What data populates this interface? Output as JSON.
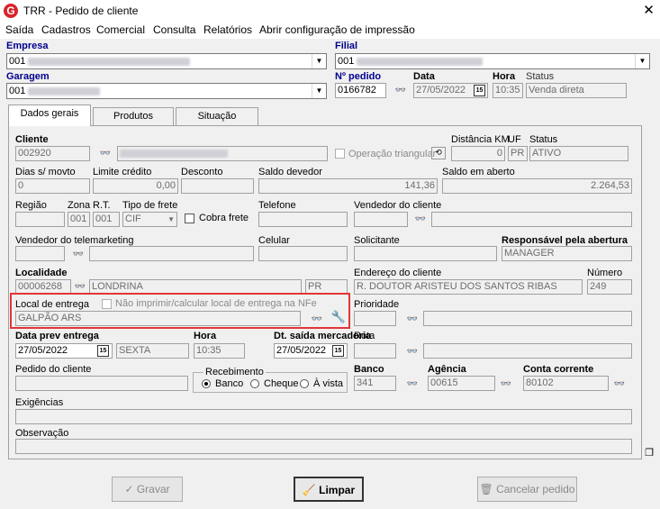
{
  "window": {
    "title": "TRR - Pedido de cliente",
    "logo": "G",
    "close": "✕"
  },
  "menu": [
    "Saída",
    "Cadastros",
    "Comercial",
    "Consulta",
    "Relatórios",
    "Abrir configuração de impressão"
  ],
  "header": {
    "empresa_label": "Empresa",
    "empresa_value": "001",
    "filial_label": "Filial",
    "filial_value": "001",
    "garagem_label": "Garagem",
    "garagem_value": "001",
    "pedido_label": "Nº pedido",
    "pedido_value": "0166782",
    "data_label": "Data",
    "data_value": "27/05/2022",
    "hora_label": "Hora",
    "hora_value": "10:35",
    "status_label": "Status",
    "status_value": "Venda direta"
  },
  "tabs": [
    "Dados gerais",
    "Produtos",
    "Situação"
  ],
  "form": {
    "cliente_label": "Cliente",
    "cliente_value": "002920",
    "operacao_label": "Operação triangular",
    "distancia_label": "Distância KM",
    "distancia_value": "0",
    "uf_label": "UF",
    "uf_value": "PR",
    "status_label": "Status",
    "status_value": "ATIVO",
    "dias_label": "Dias s/ movto",
    "dias_value": "0",
    "limite_label": "Limite crédito",
    "limite_value": "0,00",
    "desconto_label": "Desconto",
    "desconto_value": "",
    "saldo_devedor_label": "Saldo devedor",
    "saldo_devedor_value": "141,36",
    "saldo_aberto_label": "Saldo em aberto",
    "saldo_aberto_value": "2.264,53",
    "regiao_label": "Região",
    "zona_label": "Zona",
    "zona_value": "001",
    "rt_label": "R.T.",
    "rt_value": "001",
    "frete_label": "Tipo de frete",
    "frete_value": "CIF",
    "cobra_frete_label": "Cobra frete",
    "telefone_label": "Telefone",
    "vendedor_cliente_label": "Vendedor do cliente",
    "vendedor_tele_label": "Vendedor do telemarketing",
    "celular_label": "Celular",
    "solicitante_label": "Solicitante",
    "responsavel_label": "Responsável pela abertura",
    "responsavel_value": "MANAGER",
    "localidade_label": "Localidade",
    "localidade_code": "00006268",
    "localidade_value": "LONDRINA",
    "localidade_uf": "PR",
    "endereco_label": "Endereço do cliente",
    "endereco_value": "R. DOUTOR ARISTEU DOS SANTOS RIBAS",
    "numero_label": "Número",
    "numero_value": "249",
    "local_entrega_label": "Local de entrega",
    "nao_imprimir_label": "Não imprimir/calcular local de entrega na NFe",
    "local_entrega_value": "GALPÃO ARS",
    "prioridade_label": "Prioridade",
    "data_prev_label": "Data prev entrega",
    "data_prev_value": "27/05/2022",
    "dia_semana": "SEXTA",
    "hora_label": "Hora",
    "hora_value": "10:35",
    "dt_saida_label": "Dt. saída mercadoria",
    "dt_saida_value": "27/05/2022",
    "rota_label": "Rota",
    "pedido_cliente_label": "Pedido do cliente",
    "recebimento_label": "Recebimento",
    "recebimento_options": [
      "Banco",
      "Cheque",
      "À vista"
    ],
    "banco_label": "Banco",
    "banco_value": "341",
    "agencia_label": "Agência",
    "agencia_value": "00615",
    "conta_label": "Conta corrente",
    "conta_value": "80102",
    "exigencias_label": "Exigências",
    "observacao_label": "Observação",
    "calendar_glyph": "15"
  },
  "buttons": {
    "gravar": "Gravar",
    "limpar": "Limpar",
    "cancelar": "Cancelar pedido"
  }
}
